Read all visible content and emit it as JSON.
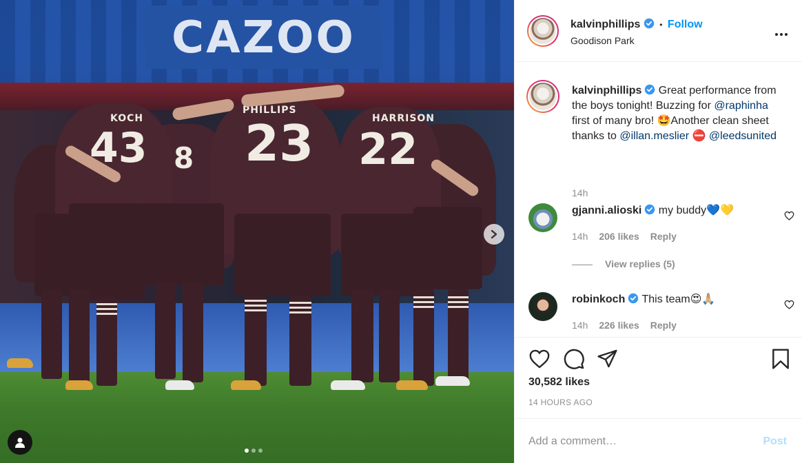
{
  "post": {
    "image": {
      "board_text": "CAZOO",
      "players": [
        {
          "name": "KOCH",
          "number": "43"
        },
        {
          "name": "",
          "number": "8"
        },
        {
          "name": "PHILLIPS",
          "number": "23"
        },
        {
          "name": "HARRISON",
          "number": "22"
        }
      ],
      "carousel": {
        "count": 3,
        "active": 1
      }
    },
    "header": {
      "username": "kalvinphillips",
      "separator": "•",
      "follow_label": "Follow",
      "location": "Goodison Park",
      "more_label": "•••"
    },
    "caption": {
      "username": "kalvinphillips",
      "text_1": " Great performance from the boys tonight! Buzzing for ",
      "mention_1": "@raphinha",
      "text_2": " first of many bro! 🤩Another clean sheet thanks to ",
      "mention_2": "@illan.meslier",
      "text_3": " ⛔ ",
      "mention_3": "@leedsunited",
      "time": "14h"
    },
    "comments": [
      {
        "username": "gjanni.alioski",
        "text": " my buddy💙💛",
        "time": "14h",
        "likes": "206 likes",
        "reply_label": "Reply",
        "view_replies": "View replies (5)"
      },
      {
        "username": "robinkoch",
        "text": " This team😍🙏🏼",
        "time": "14h",
        "likes": "226 likes",
        "reply_label": "Reply"
      }
    ],
    "likes": "30,582 likes",
    "posted": "14 HOURS AGO",
    "add_comment": {
      "placeholder": "Add a comment…",
      "post_label": "Post"
    },
    "colors": {
      "accent": "#0095f6",
      "mention": "#00376b",
      "muted": "#8e8e8e",
      "post_disabled": "#b2dffc"
    }
  }
}
